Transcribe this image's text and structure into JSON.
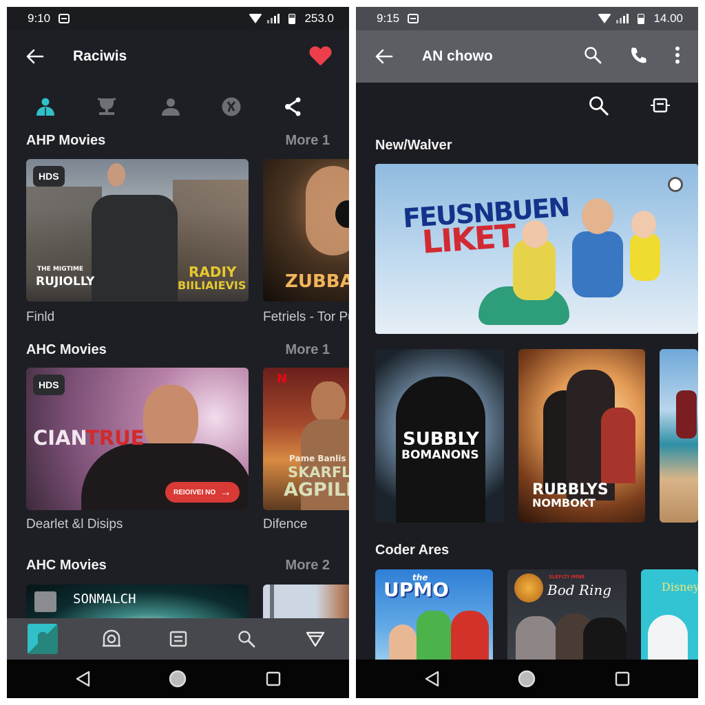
{
  "left_screen": {
    "status": {
      "time": "9:10",
      "value": "253.0"
    },
    "app_bar": {
      "title": "Raciwis",
      "back_icon": "arrow-left-icon",
      "favorite_icon": "heart-icon"
    },
    "category_icons": [
      {
        "name": "people-icon",
        "active": true
      },
      {
        "name": "trophy-icon",
        "active": false
      },
      {
        "name": "person-icon",
        "active": false
      },
      {
        "name": "badge-icon",
        "active": false
      },
      {
        "name": "share-icon",
        "active": false
      }
    ],
    "sections": [
      {
        "title": "AHP Movies",
        "more": "More 1",
        "items": [
          {
            "badge": "HDS",
            "poster_line1": "THE MIGTIME",
            "poster_line2": "RUJIOLLY",
            "poster_line3": "RADIY",
            "poster_line4": "BIILIAIEVIS",
            "caption": "Finld"
          },
          {
            "poster_line1": "ZUBBALIA",
            "caption": "Fetriels - Tor Pu"
          }
        ]
      },
      {
        "title": "AHC Movies",
        "more": "More 1",
        "items": [
          {
            "badge": "HDS",
            "poster_line1": "CIAN",
            "poster_line2": "TRUE",
            "cta": "REIOIVEI NO",
            "caption": "Dearlet &l Disips"
          },
          {
            "brand": "N",
            "poster_line1": "Pame Banlis",
            "poster_line2": "SKARFLE",
            "poster_line3": "AGPILL",
            "caption": "Difence"
          }
        ]
      },
      {
        "title": "AHC Movies",
        "more": "More 2",
        "items": [
          {
            "poster_line1": "SONMALCH"
          },
          {}
        ]
      }
    ],
    "bottom_nav": [
      {
        "name": "home-tile-icon",
        "active": true
      },
      {
        "name": "camera-icon",
        "active": false
      },
      {
        "name": "list-icon",
        "active": false
      },
      {
        "name": "search-icon",
        "active": false
      },
      {
        "name": "filter-icon",
        "active": false
      }
    ],
    "system_nav": [
      "back",
      "home",
      "recents"
    ]
  },
  "right_screen": {
    "status": {
      "time": "9:15",
      "value": "14.00"
    },
    "app_bar": {
      "title": "AN chowo",
      "back_icon": "arrow-left-icon",
      "actions": [
        "search-icon",
        "phone-icon",
        "more-vert-icon"
      ]
    },
    "tools": [
      "search-icon",
      "cast-icon"
    ],
    "sections": [
      {
        "title": "New/Walver",
        "hero": {
          "line1": "FEUSNBUEN",
          "line2": "LIKET"
        }
      },
      {
        "title": "",
        "items": [
          {
            "poster_line1": "SUBBLY",
            "poster_line2": "BOMANONS"
          },
          {
            "poster_line1": "RUBBLYS",
            "poster_line2": "NOMBOKT"
          },
          {}
        ]
      },
      {
        "title": "Coder Ares",
        "items": [
          {
            "poster_line1": "UPMO",
            "poster_small": "the"
          },
          {
            "poster_line1": "Bod Ring",
            "poster_small": "SLEFLTI IMNE"
          },
          {
            "poster_line1": "Disney"
          }
        ]
      }
    ],
    "system_nav": [
      "back",
      "home",
      "recents"
    ]
  },
  "colors": {
    "accent_teal": "#2fc0c8",
    "heart_red": "#ec3f4b",
    "cta_red": "#d93a35",
    "bg_dark": "#1d1f24",
    "app_bar_gray": "#5c5e64"
  }
}
